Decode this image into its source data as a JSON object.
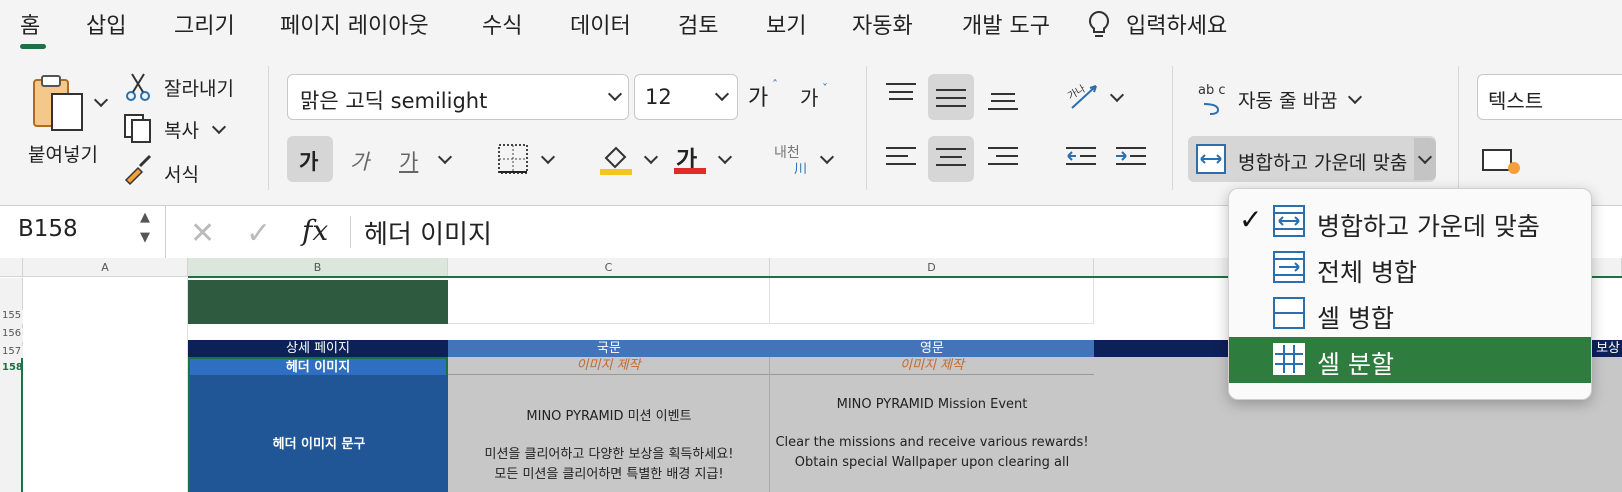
{
  "tabs": [
    "홈",
    "삽입",
    "그리기",
    "페이지 레이아웃",
    "수식",
    "데이터",
    "검토",
    "보기",
    "자동화",
    "개발 도구"
  ],
  "tell_me": "입력하세요",
  "clipboard": {
    "paste_label": "붙여넣기",
    "cut_label": "잘라내기",
    "copy_label": "복사",
    "format_label": "서식"
  },
  "font": {
    "name": "맑은 고딕 semilight",
    "size": "12",
    "grow_label": "가",
    "shrink_label": "가",
    "bold_label": "가",
    "italic_label": "가",
    "underline_label": "가",
    "font_color_label": "가",
    "phonetic_label": "내천",
    "phonetic_sub": "川"
  },
  "alignment": {
    "wrap_text_label": "자동 줄 바꿈",
    "merge_center_label": "병합하고 가운데 맞춤",
    "wrap_icon_text": "ab c",
    "orient_icon_text": "가나"
  },
  "number": {
    "format": "텍스트"
  },
  "formula_bar": {
    "cell_ref": "B158",
    "fx_label": "fx",
    "value": "헤더 이미지"
  },
  "columns": [
    "A",
    "B",
    "C",
    "D"
  ],
  "rows": [
    "155",
    "156",
    "157",
    "158"
  ],
  "cells": {
    "b157": "상세 페이지",
    "c157": "국문",
    "d157": "영문",
    "e157": "보상",
    "b158": "헤더 이미지",
    "c158": "이미지 제작",
    "d158": "이미지 제작",
    "b159": "헤더 이미지 문구",
    "c159_line1": "MINO PYRAMID 미션 이벤트",
    "c159_line2": "미션을 클리어하고 다양한 보상을 획득하세요!",
    "c159_line3": "모든 미션을 클리어하면 특별한 배경 지급!",
    "d159_line1": "MINO PYRAMID Mission Event",
    "d159_line2": "Clear the missions and receive various rewards!",
    "d159_line3": "Obtain special Wallpaper upon clearing all"
  },
  "merge_menu": {
    "items": [
      {
        "label": "병합하고 가운데 맞춤",
        "checked": true
      },
      {
        "label": "전체 병합",
        "checked": false
      },
      {
        "label": "셀 병합",
        "checked": false
      },
      {
        "label": "셀 분할",
        "checked": false,
        "highlighted": true
      }
    ],
    "check_mark": "✓"
  },
  "colors": {
    "accent": "#1e7145",
    "header_navy": "#0c2158",
    "header_blue": "#4374b9",
    "dark_green": "#2e5a3f",
    "merged_blue": "#205695",
    "orange": "#c6692a",
    "gray_cell": "#c7c7c7",
    "menu_highlight": "#2e7d3f",
    "fill_yellow": "#f4c51e",
    "font_red": "#e02b2b"
  }
}
